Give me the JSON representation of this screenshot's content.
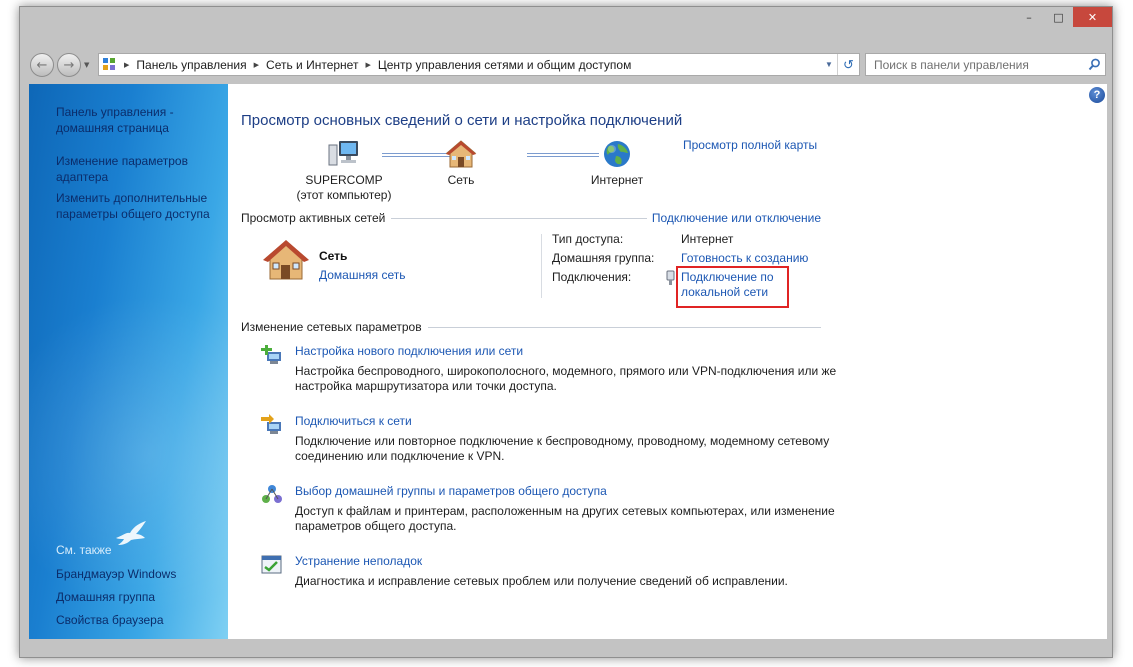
{
  "window": {
    "caption": {
      "minimize": "–",
      "maximize": "□",
      "close": "✕"
    }
  },
  "navigation": {
    "back_glyph": "←",
    "forward_glyph": "→",
    "breadcrumbs": [
      "Панель управления",
      "Сеть и Интернет",
      "Центр управления сетями и общим доступом"
    ],
    "search_placeholder": "Поиск в панели управления"
  },
  "sidebar": {
    "home": "Панель управления - домашняя страница",
    "adapter": "Изменение параметров адаптера",
    "sharing": "Изменить дополнительные параметры общего доступа",
    "see_also_title": "См. также",
    "see_also": [
      "Брандмауэр Windows",
      "Домашняя группа",
      "Свойства браузера"
    ]
  },
  "main": {
    "help": "?",
    "title": "Просмотр основных сведений о сети и настройка подключений",
    "full_map": "Просмотр полной карты",
    "map": {
      "computer_name": "SUPERCOMP",
      "computer_sub": "(этот компьютер)",
      "network": "Сеть",
      "internet": "Интернет"
    },
    "active_header": "Просмотр активных сетей",
    "connect_disconnect": "Подключение или отключение",
    "active_network": {
      "name": "Сеть",
      "type": "Домашняя сеть",
      "access_label": "Тип доступа:",
      "access_value": "Интернет",
      "homegroup_label": "Домашняя группа:",
      "homegroup_value": "Готовность к созданию",
      "connections_label": "Подключения:",
      "connections_value": "Подключение по локальной сети"
    },
    "change_header": "Изменение сетевых параметров",
    "tasks": [
      {
        "title": "Настройка нового подключения или сети",
        "desc": "Настройка беспроводного, широкополосного, модемного, прямого или VPN-подключения или же настройка маршрутизатора или точки доступа."
      },
      {
        "title": "Подключиться к сети",
        "desc": "Подключение или повторное подключение к беспроводному, проводному, модемному сетевому соединению или подключение к VPN."
      },
      {
        "title": "Выбор домашней группы и параметров общего доступа",
        "desc": "Доступ к файлам и принтерам, расположенным на других сетевых компьютерах, или изменение параметров общего доступа."
      },
      {
        "title": "Устранение неполадок",
        "desc": "Диагностика и исправление сетевых проблем или получение сведений об исправлении."
      }
    ]
  },
  "colors": {
    "link": "#1c57b3",
    "title": "#1e3f86",
    "highlight": "#e02424",
    "close": "#c7483d"
  }
}
